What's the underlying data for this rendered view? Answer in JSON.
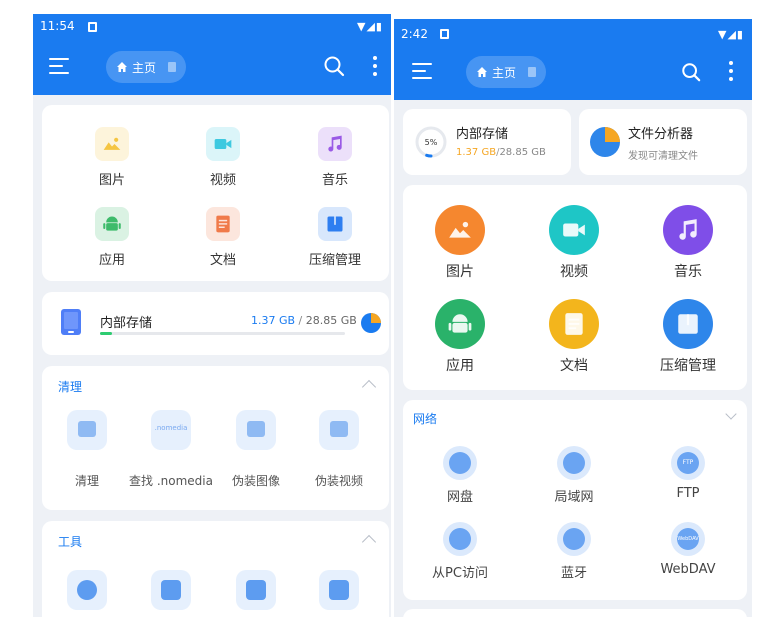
{
  "left": {
    "status": {
      "time": "11:54"
    },
    "breadcrumb": {
      "label": "主页"
    },
    "quick_access": [
      {
        "label": "图片",
        "icon": "picture-icon",
        "color": "#f5c542"
      },
      {
        "label": "视频",
        "icon": "video-icon",
        "color": "#3ec9e0"
      },
      {
        "label": "音乐",
        "icon": "music-icon",
        "color": "#9a5ae6"
      },
      {
        "label": "应用",
        "icon": "android-icon",
        "color": "#3dbb6b"
      },
      {
        "label": "文档",
        "icon": "document-icon",
        "color": "#f07a4a"
      },
      {
        "label": "压缩管理",
        "icon": "archive-icon",
        "color": "#2e7ef0"
      }
    ],
    "storage": {
      "title": "内部存储",
      "used": "1.37 GB",
      "separator": " / ",
      "total": "28.85 GB",
      "fraction": 0.047
    },
    "clean": {
      "title": "清理",
      "items": [
        "清理",
        "查找 .nomedia",
        "伪装图像",
        "伪装视频"
      ],
      "nomedia_badge": ".nomedia"
    },
    "tools": {
      "title": "工具"
    }
  },
  "right": {
    "status": {
      "time": "2:42"
    },
    "breadcrumb": {
      "label": "主页"
    },
    "storage": {
      "title": "内部存储",
      "used": "1.37 GB",
      "separator": "/",
      "total": "28.85 GB",
      "ring_label": "5%",
      "fraction": 0.05
    },
    "analyzer": {
      "title": "文件分析器",
      "subtitle": "发现可清理文件"
    },
    "quick_access": [
      {
        "label": "图片",
        "icon": "picture-icon",
        "color": "#f5872f"
      },
      {
        "label": "视频",
        "icon": "video-icon",
        "color": "#1ec6c6"
      },
      {
        "label": "音乐",
        "icon": "music-icon",
        "color": "#7f4ee8"
      },
      {
        "label": "应用",
        "icon": "android-icon",
        "color": "#2ab26a"
      },
      {
        "label": "文档",
        "icon": "document-icon",
        "color": "#f3b51c"
      },
      {
        "label": "压缩管理",
        "icon": "archive-icon",
        "color": "#2e86ea"
      }
    ],
    "network": {
      "title": "网络",
      "items": [
        "网盘",
        "局域网",
        "FTP",
        "从PC访问",
        "蓝牙",
        "WebDAV"
      ],
      "ftp_badge": "FTP",
      "webdav_badge": "WebDAV"
    }
  },
  "colors": {
    "primary": "#1a7bf0",
    "accent_orange": "#f5a623",
    "progress_green": "#2ecc71"
  }
}
